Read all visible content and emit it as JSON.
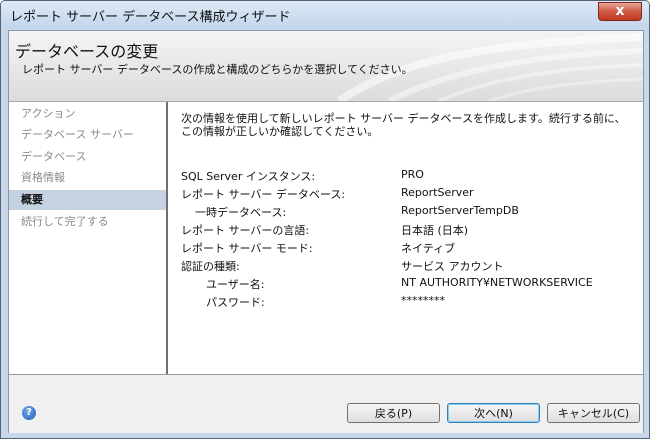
{
  "window": {
    "title": "レポート サーバー データベース構成ウィザード",
    "close_label": "x"
  },
  "header": {
    "title": "データベースの変更",
    "subtitle": "レポート サーバー データベースの作成と構成のどちらかを選択してください。"
  },
  "sidebar": {
    "items": [
      {
        "label": "アクション"
      },
      {
        "label": "データベース サーバー"
      },
      {
        "label": "データベース"
      },
      {
        "label": "資格情報"
      },
      {
        "label": "概要"
      },
      {
        "label": "続行して完了する"
      }
    ],
    "active_index": 4
  },
  "main": {
    "intro": "次の情報を使用して新しいレポート サーバー データベースを作成します。続行する前に、この情報が正しいか確認してください。",
    "summary": [
      {
        "label": "SQL Server インスタンス:",
        "value": "PRO"
      },
      {
        "label": "レポート サーバー データベース:",
        "value": "ReportServer"
      },
      {
        "label": "一時データベース:",
        "value": "ReportServerTempDB"
      },
      {
        "label": "レポート サーバーの言語:",
        "value": "日本語 (日本)"
      },
      {
        "label": "レポート サーバー モード:",
        "value": "ネイティブ"
      },
      {
        "label": "認証の種類:",
        "value": "サービス アカウント"
      },
      {
        "label": "ユーザー名:",
        "value": "NT AUTHORITY¥NETWORKSERVICE"
      },
      {
        "label": "パスワード:",
        "value": "********"
      }
    ]
  },
  "footer": {
    "help_icon": "question-icon",
    "help_glyph": "?",
    "back_label": "戻る(P)",
    "next_label": "次へ(N)",
    "cancel_label": "キャンセル(C)"
  },
  "colors": {
    "frame": "#c8d8ea",
    "close_button": "#c0391f",
    "selected_item": "#c5d2e1"
  }
}
